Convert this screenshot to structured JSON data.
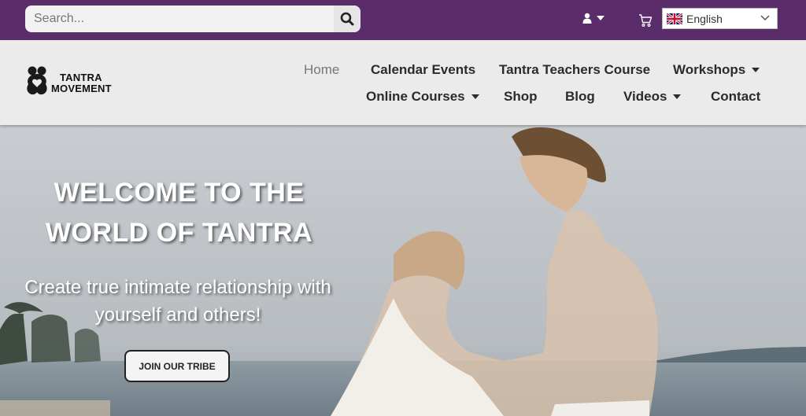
{
  "topbar": {
    "search_placeholder": "Search...",
    "search_icon": "search-icon",
    "user_icon": "user-icon",
    "cart_icon": "cart-icon",
    "language": {
      "flag": "uk-flag-icon",
      "selected": "English"
    },
    "bg_color": "#5b2c6a"
  },
  "header": {
    "logo": {
      "line1": "TANTRA",
      "line2": "MOVEMENT"
    },
    "nav_row1": [
      "Home",
      "Calendar Events",
      "Tantra Teachers Course",
      "Workshops"
    ],
    "nav_row2": [
      "Online Courses",
      "Shop",
      "Blog",
      "Videos",
      "Contact"
    ],
    "active": "Home"
  },
  "hero": {
    "title_line1": "WELCOME TO THE",
    "title_line2": "WORLD OF TANTRA",
    "subtitle_line1": "Create true intimate relationship with",
    "subtitle_line2": "yourself and others!",
    "cta_label": "JOIN OUR TRIBE"
  }
}
